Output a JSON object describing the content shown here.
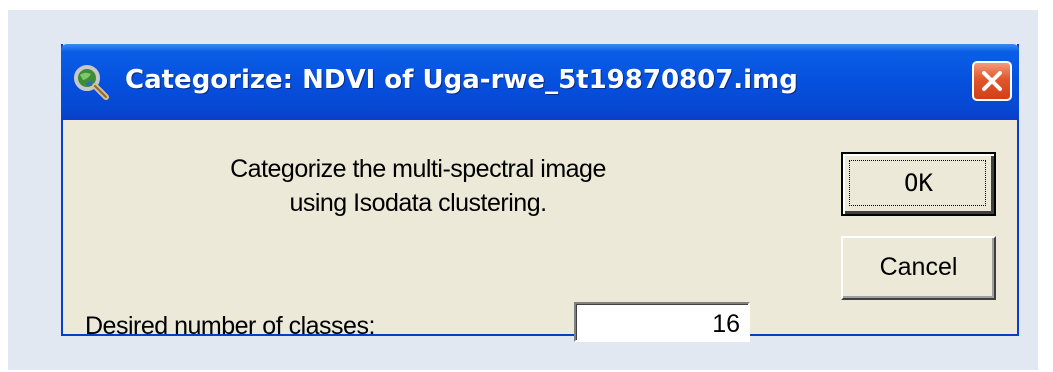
{
  "dialog": {
    "title": "Categorize: NDVI of Uga-rwe_5t19870807.img",
    "app_icon": "magnifier-globe-icon",
    "close_icon": "close-icon",
    "description_line1": "Categorize the multi-spectral image",
    "description_line2": "using Isodata clustering.",
    "classes_label": "Desired number of classes:",
    "classes_value": "16",
    "ok_label": "OK",
    "cancel_label": "Cancel"
  },
  "colors": {
    "titlebar": "#0550de",
    "window_bg": "#ece9d8",
    "close_button": "#e2562a"
  }
}
